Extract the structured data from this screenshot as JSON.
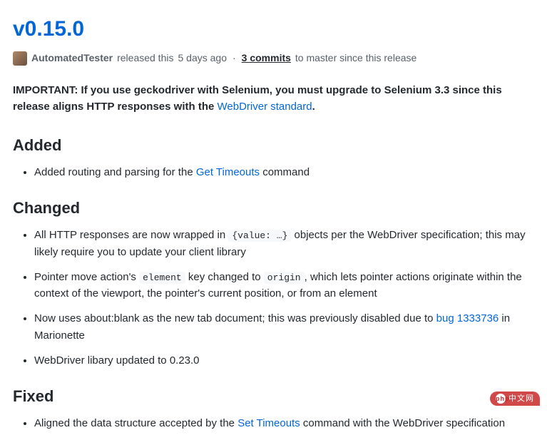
{
  "title": "v0.15.0",
  "byline": {
    "author": "AutomatedTester",
    "released_text": "released this",
    "relative_time": "5 days ago",
    "commits_label": "3 commits",
    "commits_suffix": "to master since this release"
  },
  "notice": {
    "strong_prefix": "IMPORTANT: If you use geckodriver with Selenium, you must upgrade to Selenium 3.3 since this release aligns HTTP responses with the ",
    "link_text": "WebDriver standard",
    "suffix": "."
  },
  "sections": {
    "added": {
      "heading": "Added",
      "item0_pre": "Added routing and parsing for the ",
      "item0_link": "Get Timeouts",
      "item0_post": " command"
    },
    "changed": {
      "heading": "Changed",
      "item0_pre": "All HTTP responses are now wrapped in ",
      "item0_code": "{value: …}",
      "item0_post": " objects per the WebDriver specification; this may likely require you to update your client library",
      "item1_pre": "Pointer move action's ",
      "item1_code1": "element",
      "item1_mid": " key changed to ",
      "item1_code2": "origin",
      "item1_post": ", which lets pointer actions originate within the context of the viewport, the pointer's current position, or from an element",
      "item2_pre": "Now uses about:blank as the new tab document; this was previously disabled due to ",
      "item2_link": "bug 1333736",
      "item2_post": " in Marionette",
      "item3": "WebDriver libary updated to 0.23.0"
    },
    "fixed": {
      "heading": "Fixed",
      "item0_pre": "Aligned the data structure accepted by the ",
      "item0_link": "Set Timeouts",
      "item0_post": " command with the WebDriver specification"
    }
  },
  "watermark": "中文网"
}
